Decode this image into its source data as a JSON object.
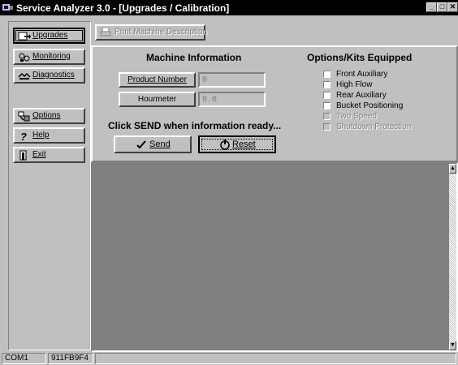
{
  "window": {
    "title": "Service Analyzer 3.0 - [Upgrades / Calibration]"
  },
  "nav": {
    "upgrades": "Upgrades",
    "monitoring": "Monitoring",
    "diagnostics": "Diagnostics",
    "options": "Options",
    "help": "Help",
    "exit": "Exit"
  },
  "toolbar": {
    "print_label": "Print Machine Description"
  },
  "machine_info": {
    "heading": "Machine Information",
    "product_number_label": "Product Number",
    "product_number_value": "0",
    "hourmeter_label": "Hourmeter",
    "hourmeter_value": "0.0",
    "send_prompt": "Click SEND when information ready...",
    "send_label": "Send",
    "reset_label": "Reset"
  },
  "options_kits": {
    "heading": "Options/Kits Equipped",
    "items": [
      {
        "label": "Front Auxiliary",
        "enabled": true,
        "checked": false
      },
      {
        "label": "High Flow",
        "enabled": true,
        "checked": false
      },
      {
        "label": "Rear Auxiliary",
        "enabled": true,
        "checked": false
      },
      {
        "label": "Bucket Positioning",
        "enabled": true,
        "checked": false
      },
      {
        "label": "Two Speed",
        "enabled": false,
        "checked": false
      },
      {
        "label": "Shutdown Protection",
        "enabled": false,
        "checked": false
      }
    ]
  },
  "statusbar": {
    "port": "COM1",
    "id": "911FB9F4"
  },
  "icons": {
    "app": "app-icon",
    "upgrades": "upgrade-icon",
    "monitoring": "monitor-icon",
    "diagnostics": "diagnostic-icon",
    "options": "options-icon",
    "help": "help-icon",
    "exit": "exit-icon",
    "print": "print-icon",
    "send": "checkmark-icon",
    "reset": "reset-icon"
  }
}
